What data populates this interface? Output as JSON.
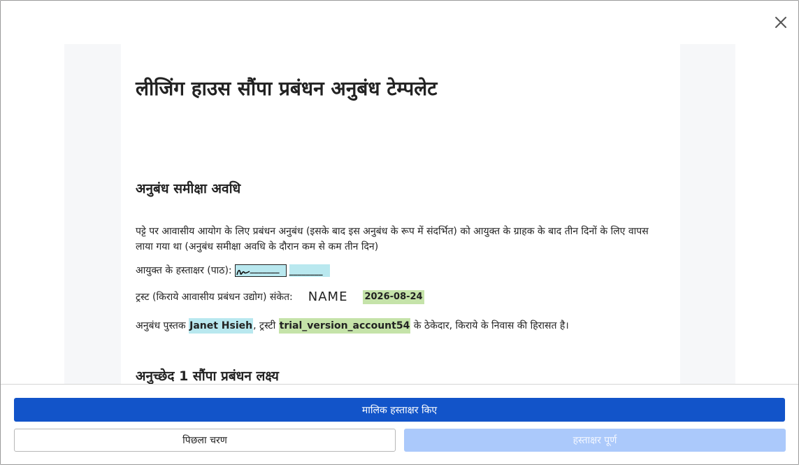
{
  "document": {
    "title": "लीजिंग हाउस सौंपा प्रबंधन अनुबंध टेम्पलेट",
    "section1_heading": "अनुबंध समीक्षा अवधि",
    "paragraph1": "पट्टे पर आवासीय आयोग के लिए प्रबंधन अनुबंध (इसके बाद इस अनुबंध के रूप में संदर्भित) को आयुक्त के ग्राहक के बाद तीन दिनों के लिए वापस लाया गया था (अनुबंध समीक्षा अवधि के दौरान कम से कम तीन दिन)",
    "commissioner_sig_label": "आयुक्त के हस्ताक्षर (पाठ):",
    "commissioner_sig_value": "_______",
    "commissioner_blank_value": "________",
    "trust_sig_label": "ट्रस्ट (किराये आवासीय प्रबंधन उद्योग) संकेत:",
    "trust_sig_name": "NAME",
    "trust_sig_date": "2026-08-24",
    "contract_line": {
      "prefix": "अनुबंध पुस्तक",
      "person": "Janet Hsieh",
      "middle": ", ट्रस्टी",
      "account": "trial_version_account54",
      "suffix": "के ठेकेदार, किराये के निवास की हिरासत है।"
    },
    "section2_heading": "अनुच्छेद 1 सौंपा प्रबंधन लक्ष्य"
  },
  "footer": {
    "owner_signed_label": "मालिक हस्ताक्षर किए",
    "previous_step_label": "पिछला चरण",
    "signature_complete_label": "हस्ताक्षर पूर्ण"
  },
  "icons": {
    "close": "close-icon",
    "signature": "signature-scribble-icon"
  },
  "colors": {
    "primary": "#1254c9",
    "disabled": "#abc9fb",
    "field_blue": "#b9e8ef",
    "field_green": "#c5e3a9"
  }
}
